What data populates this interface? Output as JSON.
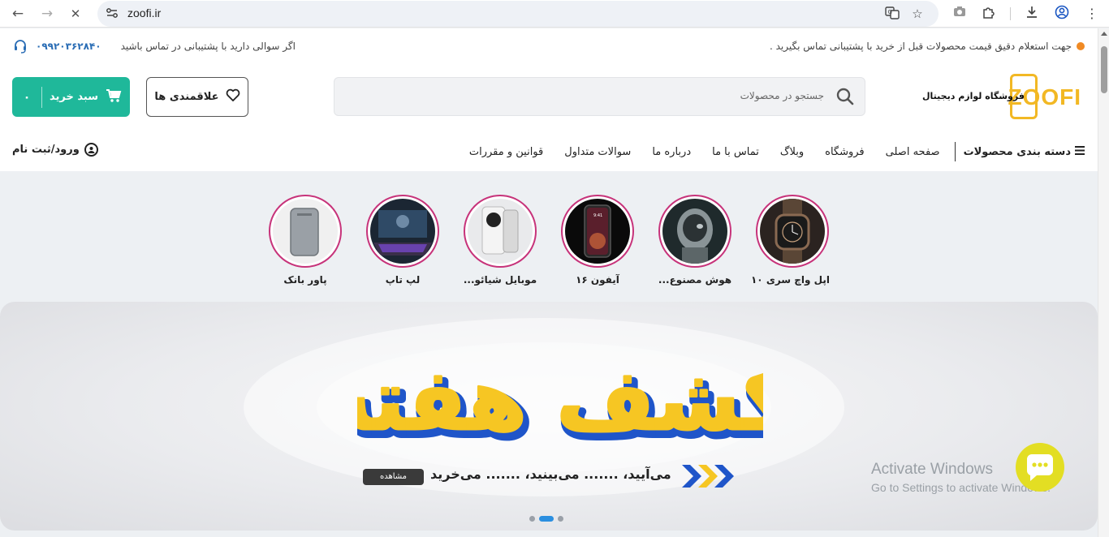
{
  "browser": {
    "url": "zoofi.ir",
    "back_icon": "←",
    "forward_icon": "→",
    "stop_icon": "✕"
  },
  "topbar": {
    "notice": "جهت استعلام دقیق قیمت محصولات قبل از خرید با پشتیبانی تماس بگیرید .",
    "support_text": "اگر سوالی دارید با پشتیبانی در تماس باشید",
    "phone": "۰۹۹۲۰۳۶۲۸۴۰"
  },
  "header": {
    "cart_label": "سبد خرید",
    "cart_count": "۰",
    "wishlist_label": "علاقمندی ها",
    "search_placeholder": "جستجو در محصولات",
    "logo_text": "ZOOFI",
    "logo_tagline": "فروشگاه لوازم دیجیتال"
  },
  "nav": {
    "categories_label": "دسته بندی محصولات",
    "items": [
      "صفحه اصلی",
      "فروشگاه",
      "وبلاگ",
      "تماس با ما",
      "درباره ما",
      "سوالات متداول",
      "قوانین و مقررات"
    ],
    "login_label": "ورود/ثبت نام"
  },
  "stories": [
    {
      "label": "اپل واچ سری ۱۰"
    },
    {
      "label": "هوش مصنوع..."
    },
    {
      "label": "آیفون ۱۶"
    },
    {
      "label": "موبایل شیائو..."
    },
    {
      "label": "لپ تاپ"
    },
    {
      "label": "پاور بانک"
    }
  ],
  "banner": {
    "title": "کشف هفته",
    "tagline": "می‌آیید، ....... می‌بینید، ....... می‌خرید",
    "button": "مشاهده",
    "slides": 3,
    "active_slide": 2
  },
  "watermark": {
    "line1": "Activate Windows",
    "line2": "Go to Settings to activate Windows."
  },
  "colors": {
    "accent": "#1fb89a",
    "brand_yellow": "#f2b824",
    "story_ring": "#c7337a",
    "banner_blue": "#1f55c9"
  }
}
